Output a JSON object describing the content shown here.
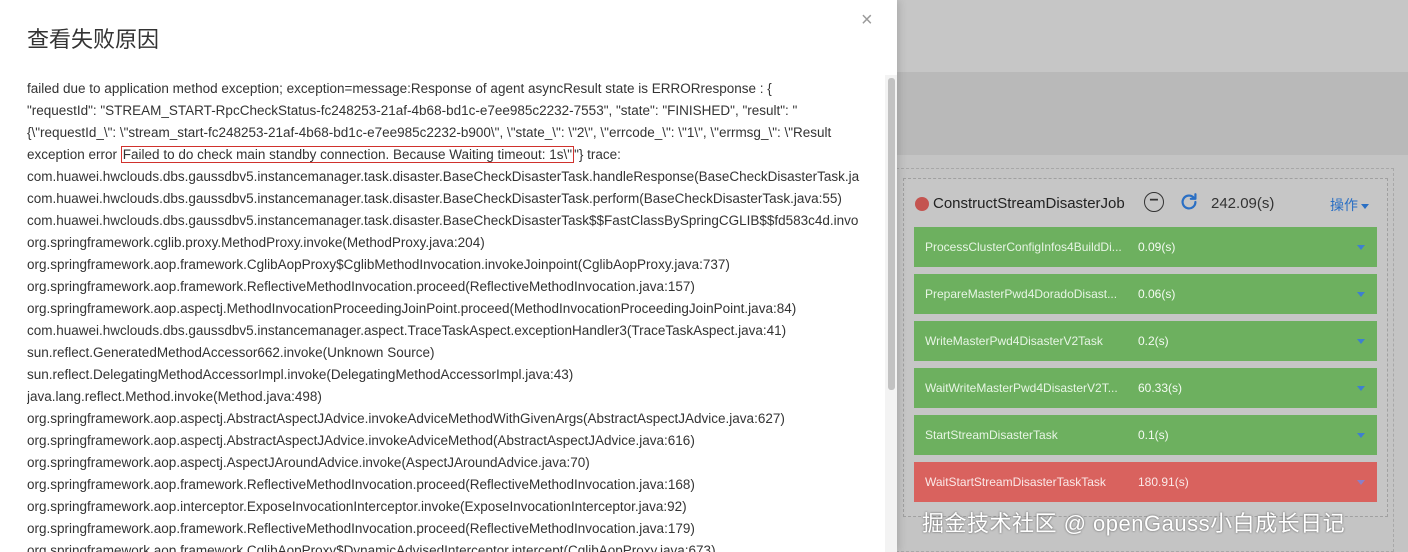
{
  "modal": {
    "title": "查看失败原因",
    "close_label": "×",
    "line3_prefix": "exception error ",
    "highlight": "Failed to do check main standby connection. Because Waiting timeout: 1s\\\"",
    "line3_suffix": "\"} trace:",
    "lines": [
      "failed due to application method exception; exception=message:Response of agent asyncResult state is ERRORresponse : {",
      "\"requestId\": \"STREAM_START-RpcCheckStatus-fc248253-21af-4b68-bd1c-e7ee985c2232-7553\", \"state\": \"FINISHED\", \"result\": \"",
      "{\\\"requestId_\\\": \\\"stream_start-fc248253-21af-4b68-bd1c-e7ee985c2232-b900\\\", \\\"state_\\\": \\\"2\\\", \\\"errcode_\\\": \\\"1\\\", \\\"errmsg_\\\": \\\"Result",
      "",
      "com.huawei.hwclouds.dbs.gaussdbv5.instancemanager.task.disaster.BaseCheckDisasterTask.handleResponse(BaseCheckDisasterTask.ja",
      "com.huawei.hwclouds.dbs.gaussdbv5.instancemanager.task.disaster.BaseCheckDisasterTask.perform(BaseCheckDisasterTask.java:55)",
      "com.huawei.hwclouds.dbs.gaussdbv5.instancemanager.task.disaster.BaseCheckDisasterTask$$FastClassBySpringCGLIB$$fd583c4d.invo",
      "org.springframework.cglib.proxy.MethodProxy.invoke(MethodProxy.java:204)",
      "org.springframework.aop.framework.CglibAopProxy$CglibMethodInvocation.invokeJoinpoint(CglibAopProxy.java:737)",
      "org.springframework.aop.framework.ReflectiveMethodInvocation.proceed(ReflectiveMethodInvocation.java:157)",
      "org.springframework.aop.aspectj.MethodInvocationProceedingJoinPoint.proceed(MethodInvocationProceedingJoinPoint.java:84)",
      "com.huawei.hwclouds.dbs.gaussdbv5.instancemanager.aspect.TraceTaskAspect.exceptionHandler3(TraceTaskAspect.java:41)",
      "sun.reflect.GeneratedMethodAccessor662.invoke(Unknown Source)",
      "sun.reflect.DelegatingMethodAccessorImpl.invoke(DelegatingMethodAccessorImpl.java:43)",
      "java.lang.reflect.Method.invoke(Method.java:498)",
      "org.springframework.aop.aspectj.AbstractAspectJAdvice.invokeAdviceMethodWithGivenArgs(AbstractAspectJAdvice.java:627)",
      "org.springframework.aop.aspectj.AbstractAspectJAdvice.invokeAdviceMethod(AbstractAspectJAdvice.java:616)",
      "org.springframework.aop.aspectj.AspectJAroundAdvice.invoke(AspectJAroundAdvice.java:70)",
      "org.springframework.aop.framework.ReflectiveMethodInvocation.proceed(ReflectiveMethodInvocation.java:168)",
      "org.springframework.aop.interceptor.ExposeInvocationInterceptor.invoke(ExposeInvocationInterceptor.java:92)",
      "org.springframework.aop.framework.ReflectiveMethodInvocation.proceed(ReflectiveMethodInvocation.java:179)",
      "org.springframework.aop.framework.CglibAopProxy$DynamicAdvisedInterceptor.intercept(CglibAopProxy.java:673)"
    ]
  },
  "job": {
    "status_color": "#c45450",
    "title": "ConstructStreamDisasterJob",
    "elapsed": "242.09(s)",
    "ops_label": "操作",
    "tasks": [
      {
        "name": "ProcessClusterConfigInfos4BuildDi...",
        "time": "0.09(s)",
        "status": "success"
      },
      {
        "name": "PrepareMasterPwd4DoradoDisast...",
        "time": "0.06(s)",
        "status": "success"
      },
      {
        "name": "WriteMasterPwd4DisasterV2Task",
        "time": "0.2(s)",
        "status": "success"
      },
      {
        "name": "WaitWriteMasterPwd4DisasterV2T...",
        "time": "60.33(s)",
        "status": "success"
      },
      {
        "name": "StartStreamDisasterTask",
        "time": "0.1(s)",
        "status": "success"
      },
      {
        "name": "WaitStartStreamDisasterTaskTask",
        "time": "180.91(s)",
        "status": "failed"
      }
    ]
  },
  "watermark": "掘金技术社区 @ openGauss小白成长日记"
}
